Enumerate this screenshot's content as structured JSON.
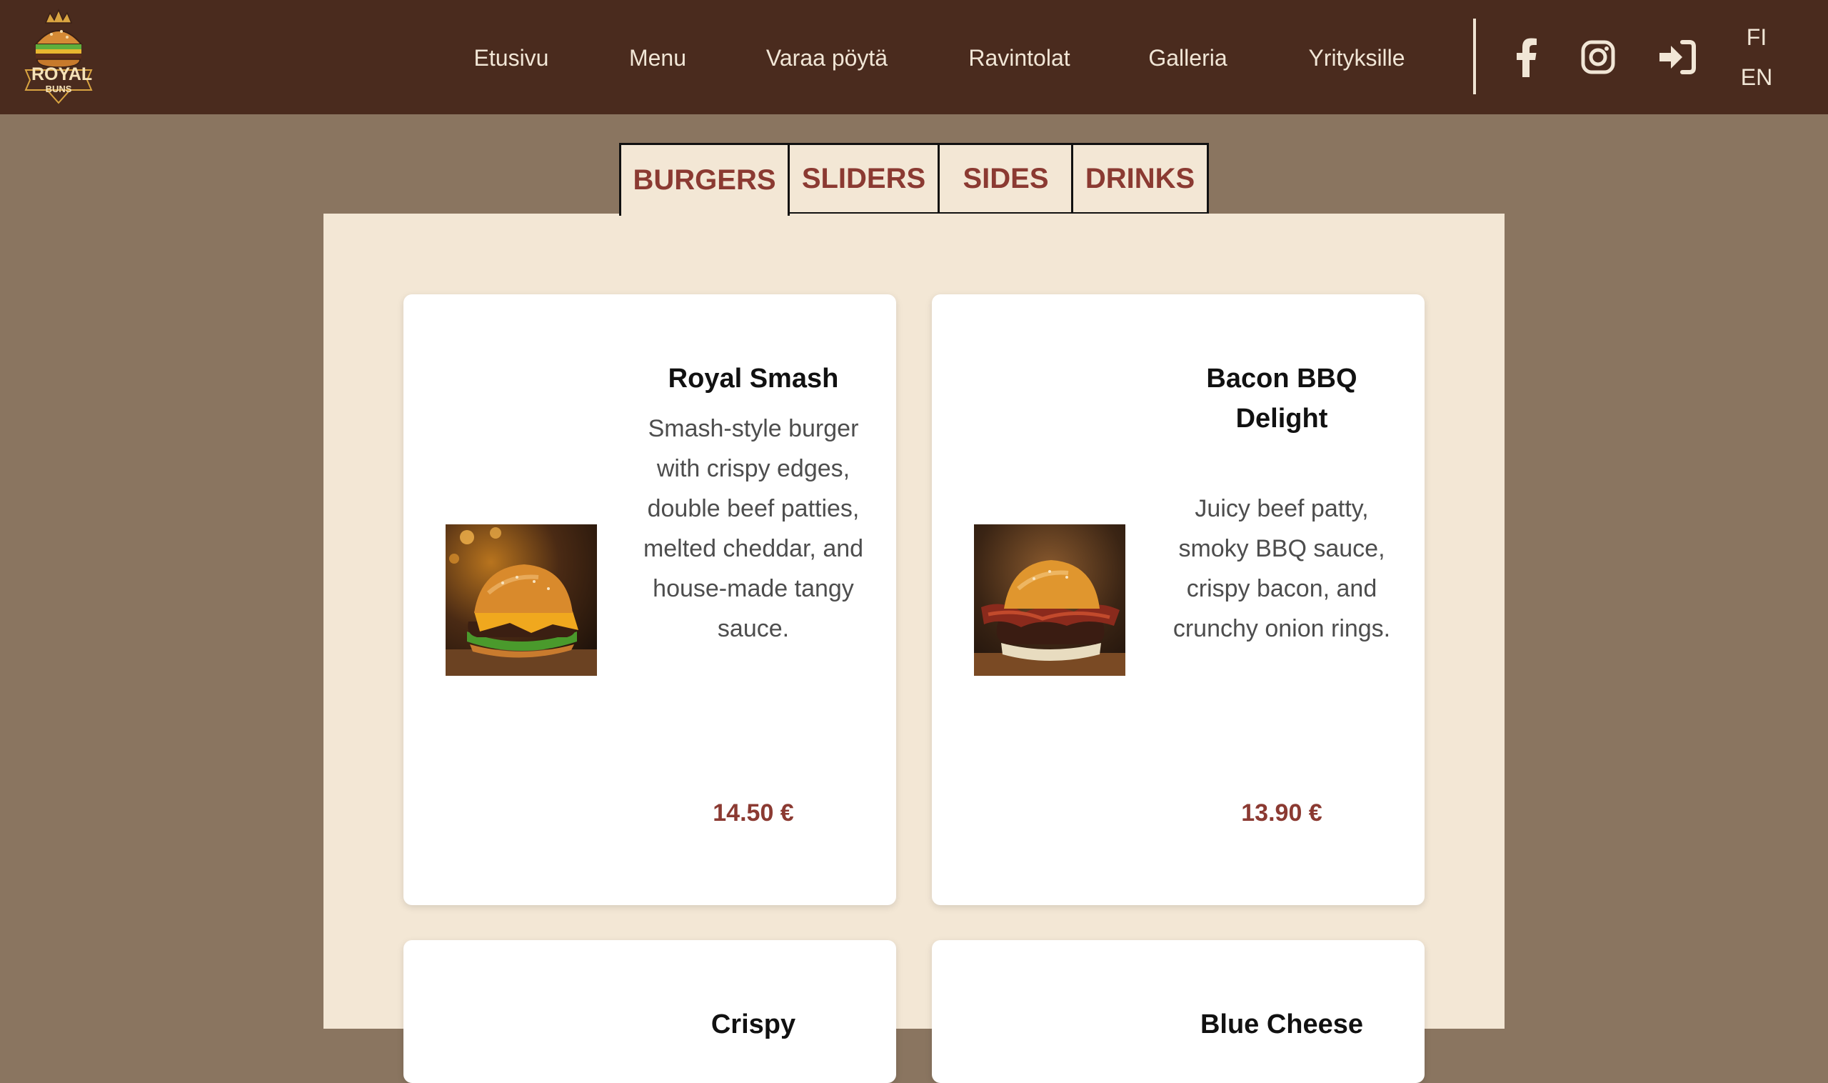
{
  "brand": {
    "logo_text": "ROYAL",
    "logo_subtext": "BUNS"
  },
  "nav": {
    "items": [
      "Etusivu",
      "Menu",
      "Varaa pöytä",
      "Ravintolat",
      "Galleria",
      "Yrityksille"
    ]
  },
  "social": [
    "facebook-icon",
    "instagram-icon",
    "login-icon"
  ],
  "languages": [
    "FI",
    "EN"
  ],
  "tabs": {
    "items": [
      "BURGERS",
      "SLIDERS",
      "SIDES",
      "DRINKS"
    ],
    "active": "BURGERS"
  },
  "menu": {
    "items": [
      {
        "name": "Royal Smash",
        "description": "Smash-style burger with crispy edges, double beef patties, melted cheddar, and house-made tangy sauce.",
        "price": "14.50 €"
      },
      {
        "name": "Bacon BBQ Delight",
        "description": "Juicy beef patty, smoky BBQ sauce, crispy bacon, and crunchy onion rings.",
        "price": "13.90 €"
      },
      {
        "name": "Crispy",
        "description": "",
        "price": ""
      },
      {
        "name": "Blue Cheese",
        "description": "",
        "price": ""
      }
    ]
  },
  "colors": {
    "header_bg": "#4a2b1e",
    "page_bg": "#8a7560",
    "panel_bg": "#f3e7d5",
    "accent": "#8b3a32",
    "nav_text": "#f1e6d6"
  }
}
